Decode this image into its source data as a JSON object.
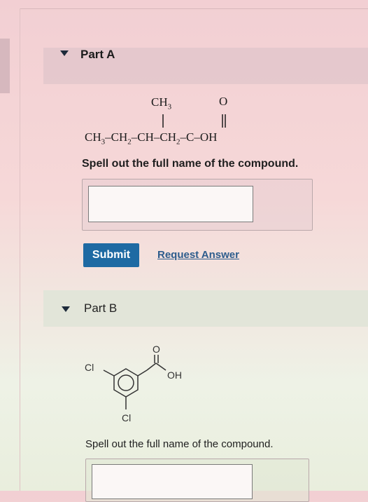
{
  "part_a": {
    "header": "Part A",
    "structure": {
      "branch_methyl": "CH3",
      "carbonyl_oxygen": "O",
      "main_chain": "CH3–CH2–CH–CH2–C–OH"
    },
    "prompt": "Spell out the full name of the compound.",
    "answer_value": "",
    "submit_label": "Submit",
    "request_answer_label": "Request Answer"
  },
  "part_b": {
    "header": "Part B",
    "structure": {
      "chloro_top": "Cl",
      "chloro_bottom": "Cl",
      "carbonyl_oxygen": "O",
      "hydroxyl": "OH"
    },
    "prompt": "Spell out the full name of the compound.",
    "answer_value": ""
  },
  "colors": {
    "submit_bg": "#1e6aa3",
    "link": "#2d5c8c"
  }
}
